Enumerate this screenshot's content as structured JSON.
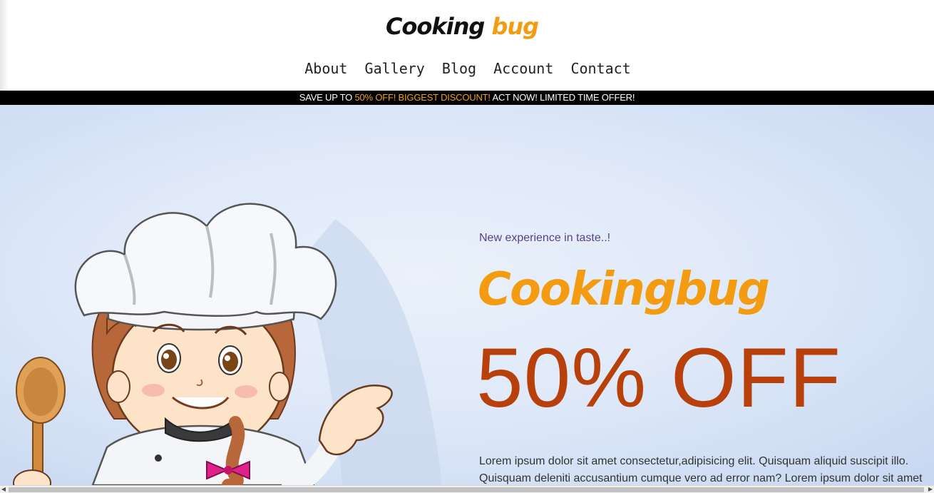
{
  "header": {
    "logo_part1": "Cooking",
    "logo_part2": "bug",
    "nav": [
      "About",
      "Gallery",
      "Blog",
      "Account",
      "Contact"
    ]
  },
  "promo": {
    "prefix": "SAVE UP TO ",
    "highlight": "50% OFF! BIGGEST DISCOUNT!",
    "suffix": " ACT NOW! LIMITED TIME OFFER!"
  },
  "hero": {
    "tagline": "New experience in taste..!",
    "brand": "Cookingbug",
    "offer": "50% OFF",
    "body": "Lorem ipsum dolor sit amet consectetur,adipisicing elit. Quisquam aliquid suscipit illo. Quisquam deleniti accusantium cumque vero ad error nam? Lorem ipsum dolor sit amet consectetur adipisicing elit. Omnis in ut perferendis voluptatem, placeat libero itaque."
  },
  "colors": {
    "accent": "#f39c12",
    "offer": "#b8400a",
    "tagline": "#5b3e8a",
    "promo_bg": "#000000"
  }
}
